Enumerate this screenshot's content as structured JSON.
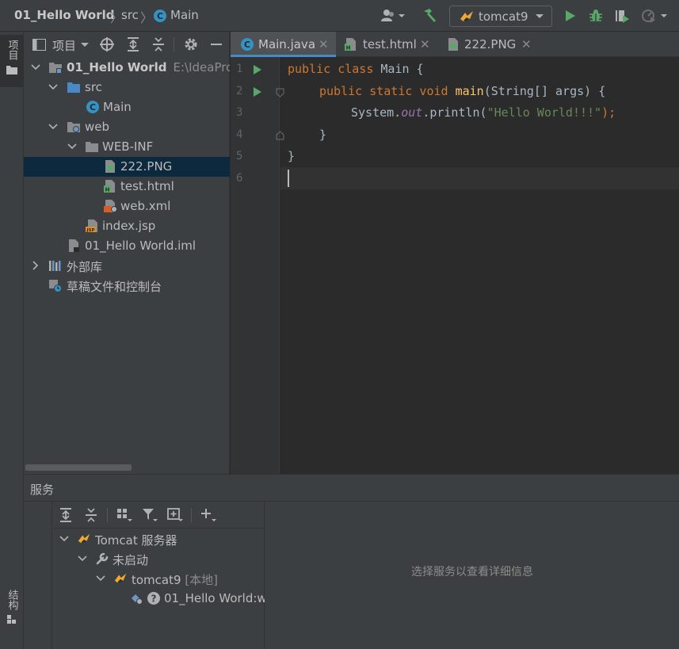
{
  "navbar": {
    "project": "01_Hello World",
    "folder": "src",
    "file": "Main",
    "run_config": "tomcat9"
  },
  "stripe": {
    "project_tab": "项目",
    "structure_tab": "结构"
  },
  "project_panel": {
    "title": "项目",
    "tree": [
      {
        "label": "01_Hello World",
        "path": "E:\\IdeaProje"
      },
      {
        "label": "src"
      },
      {
        "label": "Main"
      },
      {
        "label": "web"
      },
      {
        "label": "WEB-INF"
      },
      {
        "label": "222.PNG"
      },
      {
        "label": "test.html"
      },
      {
        "label": "web.xml"
      },
      {
        "label": "index.jsp"
      },
      {
        "label": "01_Hello World.iml"
      },
      {
        "label": "外部库"
      },
      {
        "label": "草稿文件和控制台"
      }
    ]
  },
  "editor": {
    "tabs": [
      {
        "label": "Main.java"
      },
      {
        "label": "test.html"
      },
      {
        "label": "222.PNG"
      }
    ],
    "line_numbers": [
      "1",
      "2",
      "3",
      "4",
      "5",
      "6"
    ],
    "code": {
      "l1_kw": "public class",
      "l1_rest": " Main {",
      "l2_kw": "public static void",
      "l2_fn": "main",
      "l2_rest": "(String[] args) {",
      "l3_a": "System.",
      "l3_field": "out",
      "l3_b": ".println(",
      "l3_str": "\"Hello World!!!\"",
      "l3_c": ");",
      "l4": "}",
      "l5": "}"
    }
  },
  "services": {
    "title": "服务",
    "tree": [
      {
        "label": "Tomcat 服务器"
      },
      {
        "label": "未启动"
      },
      {
        "label": "tomcat9",
        "sub": "[本地]"
      },
      {
        "label": "01_Hello World:w"
      }
    ],
    "empty_message": "选择服务以查看详细信息"
  },
  "colors": {
    "accent": "#4a88c7",
    "run_green": "#59a869",
    "keyword": "#cc7832",
    "function": "#ffc66d",
    "string": "#6a8759",
    "field": "#9876aa"
  }
}
